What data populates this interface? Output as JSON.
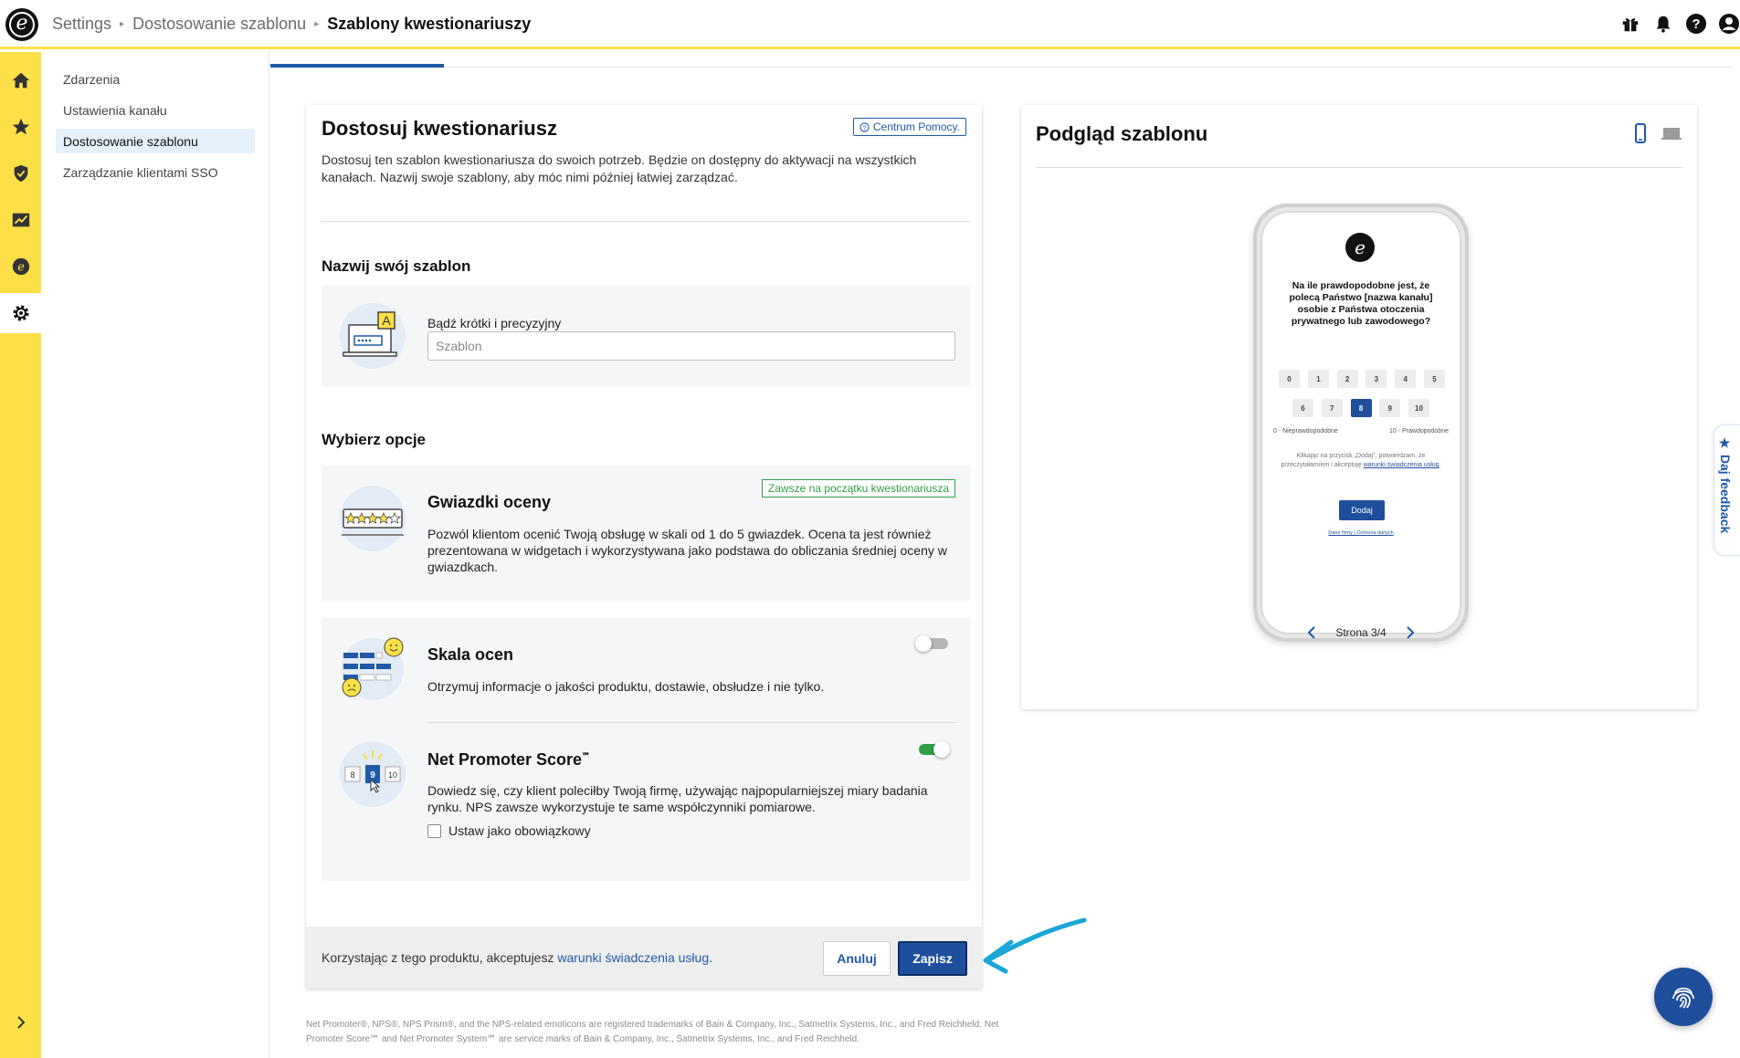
{
  "topbar": {
    "logo_letter": "e",
    "breadcrumb": [
      "Settings",
      "Dostosowanie szablonu",
      "Szablony kwestionariuszy"
    ]
  },
  "subnav": {
    "items": [
      {
        "label": "Zdarzenia",
        "active": false
      },
      {
        "label": "Ustawienia kanału",
        "active": false
      },
      {
        "label": "Dostosowanie szablonu",
        "active": true
      },
      {
        "label": "Zarządzanie klientami SSO",
        "active": false
      }
    ]
  },
  "left_card": {
    "title": "Dostosuj kwestionariusz",
    "help_label": "Centrum Pomocy.",
    "intro": "Dostosuj ten szablon kwestionariusza do swoich potrzeb. Będzie on dostępny do aktywacji na wszystkich kanałach. Nazwij swoje szablony, aby móc nimi później łatwiej zarządzać.",
    "name_section": {
      "heading": "Nazwij swój szablon",
      "field_label": "Bądź krótki i precyzyjny",
      "placeholder": "Szablon"
    },
    "options_heading": "Wybierz opcje",
    "options": {
      "stars": {
        "title": "Gwiazdki oceny",
        "badge": "Zawsze na początku kwestionariusza",
        "desc": "Pozwól klientom ocenić Twoją obsługę w skali od 1 do 5 gwiazdek. Ocena ta jest również prezentowana w widgetach i wykorzystywana jako podstawa do obliczania średniej oceny w gwiazdkach."
      },
      "scale": {
        "title": "Skala ocen",
        "desc": "Otrzymuj informacje o jakości produktu, dostawie, obsłudze i nie tylko.",
        "enabled": false
      },
      "nps": {
        "title": "Net Promoter Score",
        "title_mark": "℠",
        "desc": "Dowiedz się, czy klient poleciłby Twoją firmę, używając najpopularniejszej miary badania rynku. NPS zawsze wykorzystuje te same współczynniki pomiarowe.",
        "enabled": true,
        "required_label": "Ustaw jako obowiązkowy",
        "illus_numbers": [
          "8",
          "9",
          "10"
        ]
      }
    },
    "footer": {
      "text_prefix": "Korzystając z tego produktu, akceptujesz ",
      "link": "warunki świadczenia usług",
      "text_suffix": ".",
      "cancel_label": "Anuluj",
      "save_label": "Zapisz"
    }
  },
  "legal": "Net Promoter®, NPS®, NPS Prism®, and the NPS-related emoticons are registered trademarks of Bain & Company, Inc., Satmetrix Systems, Inc., and Fred Reichheld. Net Promoter Score℠ and Net Promoter System℠ are service marks of Bain & Company, Inc., Satmetrix Systems, Inc., and Fred Reichheld.",
  "preview": {
    "title": "Podgląd szablonu",
    "phone": {
      "logo_letter": "e",
      "question": "Na ile prawdopodobne jest, że polecą Państwo [nazwa kanału] osobie z Państwa otoczenia prywatnego lub zawodowego?",
      "row1": [
        "0",
        "1",
        "2",
        "3",
        "4",
        "5"
      ],
      "row2": [
        "6",
        "7",
        "8",
        "9",
        "10"
      ],
      "selected": "8",
      "low_label": "0 - Nieprawdopodobne",
      "high_label": "10 - Prawdopodobne",
      "consent_prefix": "Klikając na przycisk „Dodaj”, potwierdzam, że przeczytałam/em i akceptuję ",
      "consent_link": "warunki świadczenia usług",
      "consent_suffix": ".",
      "button": "Dodaj",
      "links": "Dane firmy | Ochrona danych"
    },
    "pager": "Strona 3/4"
  },
  "feedback_tab": "★ Daj feedback",
  "colors": {
    "rail": "#fde047",
    "primary": "#1f4f9c",
    "accent_link": "#1f5aa6",
    "success": "#2f9e44",
    "arrow": "#1aa6d6"
  }
}
